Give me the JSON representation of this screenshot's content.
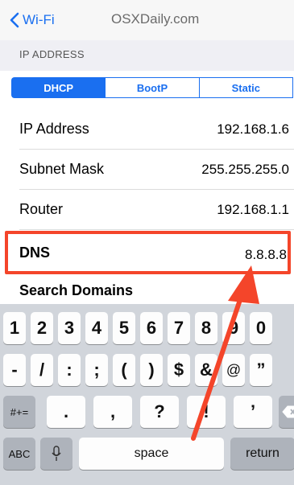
{
  "nav": {
    "back_label": "Wi-Fi",
    "title": "OSXDaily.com"
  },
  "section": {
    "header": "IP ADDRESS"
  },
  "segmented": {
    "options": [
      "DHCP",
      "BootP",
      "Static"
    ],
    "selected": "DHCP"
  },
  "rows": [
    {
      "label": "IP Address",
      "value": "192.168.1.6"
    },
    {
      "label": "Subnet Mask",
      "value": "255.255.255.0"
    },
    {
      "label": "Router",
      "value": "192.168.1.1"
    },
    {
      "label": "DNS",
      "value": "8.8.8.8"
    },
    {
      "label": "Search Domains",
      "value": ""
    }
  ],
  "keyboard": {
    "row1": [
      "1",
      "2",
      "3",
      "4",
      "5",
      "6",
      "7",
      "8",
      "9",
      "0"
    ],
    "row2": [
      "-",
      "/",
      ":",
      ";",
      "(",
      ")",
      "$",
      "&",
      "@",
      "”"
    ],
    "row3": [
      "#+=",
      ".",
      ",",
      "?",
      "!",
      "’"
    ],
    "row4": [
      "ABC",
      "space",
      "return"
    ]
  },
  "colors": {
    "accent": "#1a6ff0",
    "highlight": "#f4452a"
  }
}
